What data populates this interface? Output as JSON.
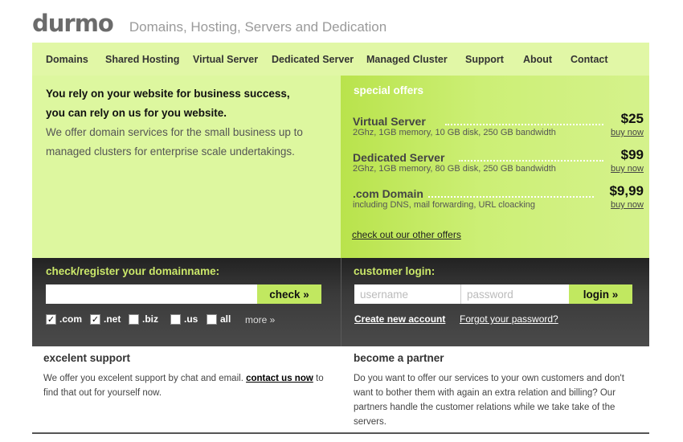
{
  "header": {
    "logo": "durmo",
    "tagline": "Domains, Hosting, Servers and Dedication"
  },
  "nav": {
    "items": [
      {
        "label": "Domains"
      },
      {
        "label": "Shared Hosting"
      },
      {
        "label": "Virtual Server"
      },
      {
        "label": "Dedicated Server"
      },
      {
        "label": "Managed Cluster"
      },
      {
        "label": "Support"
      },
      {
        "label": "About"
      },
      {
        "label": "Contact"
      }
    ]
  },
  "hero": {
    "bold_line1": "You rely on your website for business success,",
    "bold_line2": "you can rely on us for you website.",
    "text": "We offer domain services for the small business up to managed clusters for enterprise scale undertakings."
  },
  "offers": {
    "title": "special offers",
    "items": [
      {
        "name": "Virtual Server",
        "desc": "2Ghz, 1GB memory, 10 GB disk, 250 GB bandwidth",
        "price": "$25",
        "buy": "buy now"
      },
      {
        "name": "Dedicated Server",
        "desc": "2Ghz, 1GB memory, 80 GB disk, 250 GB bandwidth",
        "price": "$99",
        "buy": "buy now"
      },
      {
        "name": ".com Domain",
        "desc": "including DNS, mail forwarding, URL cloacking",
        "price": "$9,99",
        "buy": "buy now"
      }
    ],
    "other_link": "check out our other offers"
  },
  "domain_check": {
    "title": "check/register your domainname:",
    "input_value": "",
    "button": "check »",
    "tlds": [
      {
        "label": ".com",
        "checked": true
      },
      {
        "label": ".net",
        "checked": true
      },
      {
        "label": ".biz",
        "checked": false
      },
      {
        "label": ".us",
        "checked": false
      },
      {
        "label": "all",
        "checked": false
      }
    ],
    "more": "more »"
  },
  "login": {
    "title": "customer login:",
    "username_placeholder": "username",
    "password_placeholder": "password",
    "button": "login »",
    "create_account": "Create new account",
    "forgot_password": "Forgot your password?"
  },
  "support": {
    "title": "excelent support",
    "text_before": "We offer you excelent support by chat and email.",
    "link": "contact us now",
    "text_after": "to find that out for yourself now."
  },
  "partner": {
    "title": "become a partner",
    "text": "Do you want to offer our services to your own customers and don't want to bother them with again an extra relation and billing?  Our partners handle the customer relations while we take take of the servers."
  }
}
